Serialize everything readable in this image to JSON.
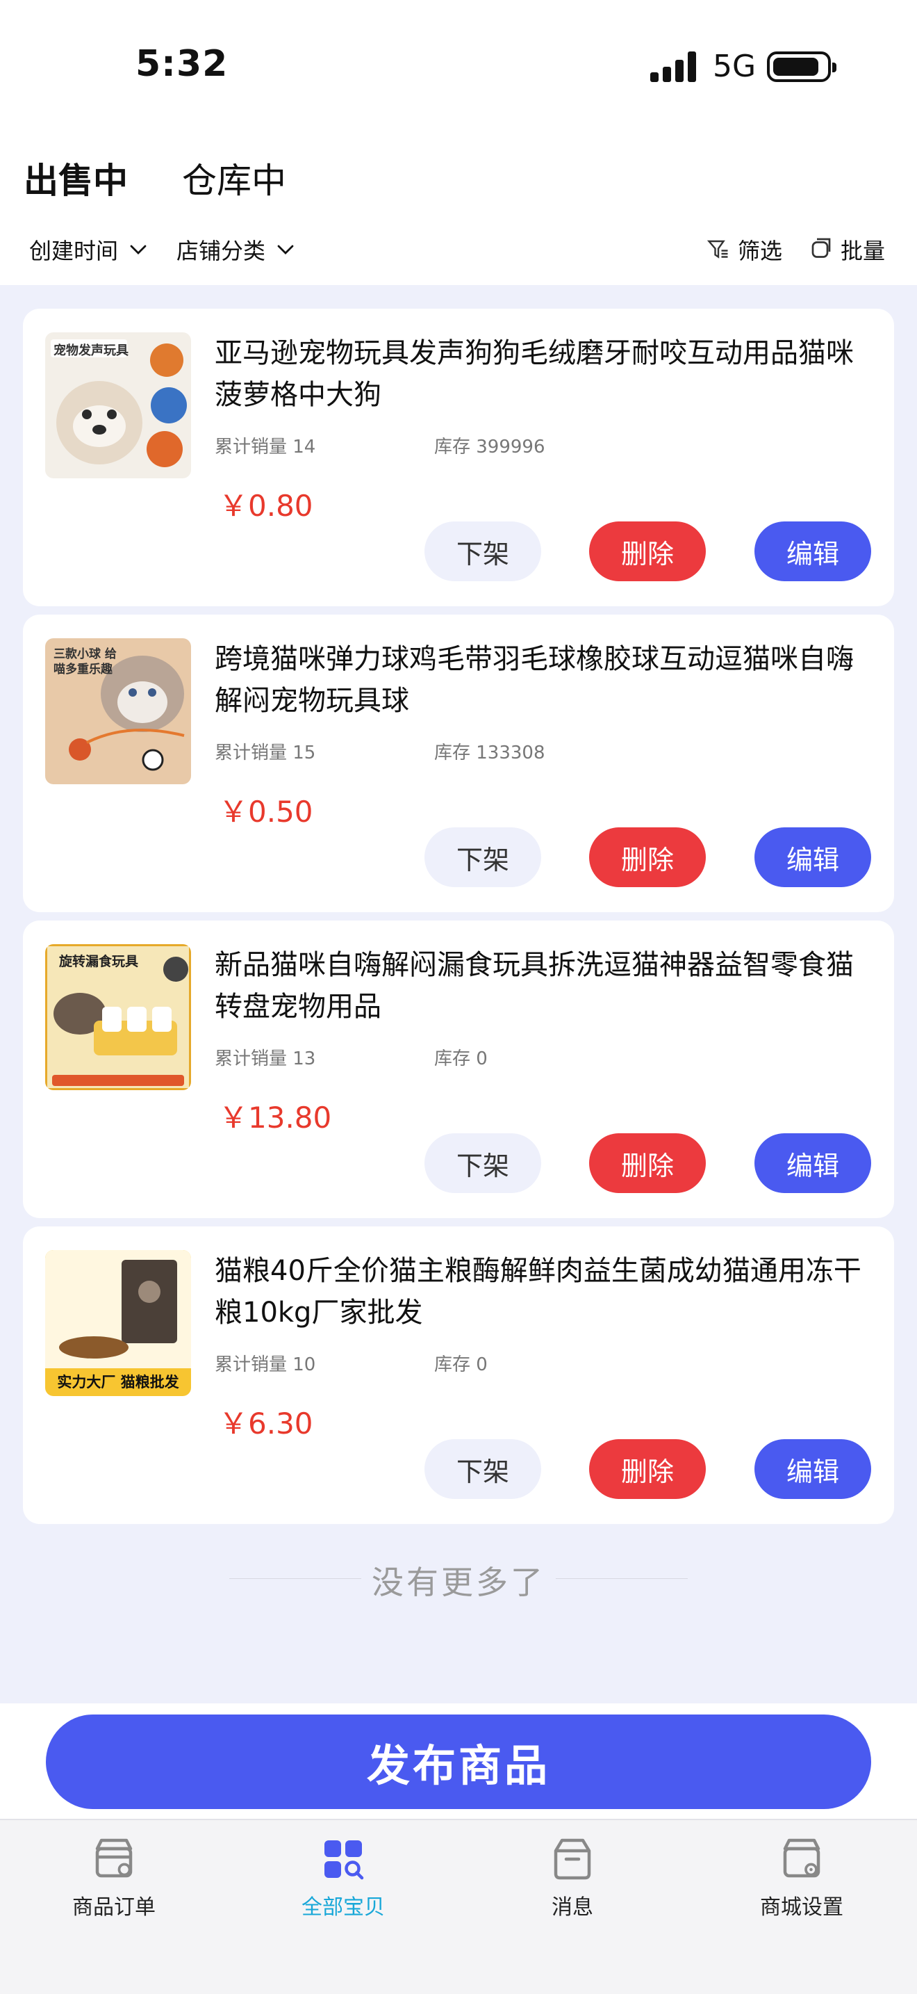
{
  "status_bar": {
    "time": "5:32",
    "network": "5G"
  },
  "tabs": [
    {
      "label": "出售中",
      "active": true
    },
    {
      "label": "仓库中",
      "active": false
    }
  ],
  "filters": {
    "created_time": "创建时间",
    "shop_category": "店铺分类",
    "filter": "筛选",
    "batch": "批量"
  },
  "products": [
    {
      "name": "亚马逊宠物玩具发声狗狗毛绒磨牙耐咬互动用品猫咪菠萝格中大狗",
      "sales": "累计销量 14",
      "stock": "库存 399996",
      "price": "￥0.80",
      "thumb_text": "宠物发声玩具",
      "thumb_color": "#f3efe8"
    },
    {
      "name": "跨境猫咪弹力球鸡毛带羽毛球橡胶球互动逗猫咪自嗨解闷宠物玩具球",
      "sales": "累计销量 15",
      "stock": "库存 133308",
      "price": "￥0.50",
      "thumb_text": "三款小球 给喵多重乐趣",
      "thumb_color": "#e8c9a8"
    },
    {
      "name": "新品猫咪自嗨解闷漏食玩具拆洗逗猫神器益智零食猫转盘宠物用品",
      "sales": "累计销量 13",
      "stock": "库存 0",
      "price": "￥13.80",
      "thumb_text": "旋转漏食玩具",
      "thumb_color": "#f6e7b8"
    },
    {
      "name": "猫粮40斤全价猫主粮酶解鲜肉益生菌成幼猫通用冻干粮10kg厂家批发",
      "sales": "累计销量 10",
      "stock": "库存 0",
      "price": "￥6.30",
      "thumb_text": "实力大厂 猫粮批发",
      "thumb_color": "#f7c531"
    }
  ],
  "actions": {
    "off_shelf": "下架",
    "delete": "删除",
    "edit": "编辑"
  },
  "no_more": "没有更多了",
  "publish_label": "发布商品",
  "nav": [
    {
      "label": "商品订单",
      "icon": "store-order-icon",
      "active": false
    },
    {
      "label": "全部宝贝",
      "icon": "all-items-grid-icon",
      "active": true
    },
    {
      "label": "消息",
      "icon": "message-box-icon",
      "active": false
    },
    {
      "label": "商城设置",
      "icon": "store-settings-icon",
      "active": false
    }
  ],
  "colors": {
    "accent": "#4a5af0",
    "danger": "#ec3a3e",
    "price": "#e8392c",
    "nav_active": "#18a7d8"
  }
}
